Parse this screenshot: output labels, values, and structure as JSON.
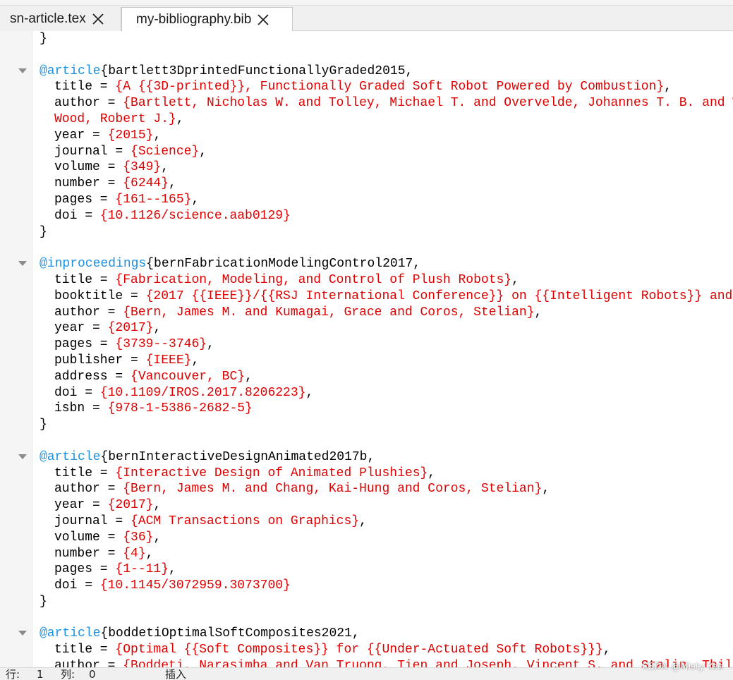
{
  "tabs": [
    {
      "label": "sn-article.tex",
      "active": false
    },
    {
      "label": "my-bibliography.bib",
      "active": true
    }
  ],
  "colors": {
    "entry_type": "#1e90e0",
    "value": "#e00000",
    "text": "#000000"
  },
  "editor": {
    "lines": [
      {
        "kind": "brace",
        "text": "}"
      },
      {
        "kind": "blank"
      },
      {
        "kind": "entry",
        "type": "@article",
        "key": "{bartlett3DprintedFunctionallyGraded2015,"
      },
      {
        "kind": "field",
        "name": "title = ",
        "value": "{A {{3D-printed}}, Functionally Graded Soft Robot Powered by Combustion}",
        "tail": ","
      },
      {
        "kind": "field",
        "name": "author = ",
        "value": "{Bartlett, Nicholas W. and Tolley, Michael T. and Overvelde, Johannes T. B. and W",
        "tail": ""
      },
      {
        "kind": "cont",
        "value": "Wood, Robert J.}",
        "tail": ","
      },
      {
        "kind": "field",
        "name": "year = ",
        "value": "{2015}",
        "tail": ","
      },
      {
        "kind": "field",
        "name": "journal = ",
        "value": "{Science}",
        "tail": ","
      },
      {
        "kind": "field",
        "name": "volume = ",
        "value": "{349}",
        "tail": ","
      },
      {
        "kind": "field",
        "name": "number = ",
        "value": "{6244}",
        "tail": ","
      },
      {
        "kind": "field",
        "name": "pages = ",
        "value": "{161--165}",
        "tail": ","
      },
      {
        "kind": "field",
        "name": "doi = ",
        "value": "{10.1126/science.aab0129}",
        "tail": ""
      },
      {
        "kind": "brace",
        "text": "}"
      },
      {
        "kind": "blank"
      },
      {
        "kind": "entry",
        "type": "@inproceedings",
        "key": "{bernFabricationModelingControl2017,"
      },
      {
        "kind": "field",
        "name": "title = ",
        "value": "{Fabrication, Modeling, and Control of Plush Robots}",
        "tail": ","
      },
      {
        "kind": "field",
        "name": "booktitle = ",
        "value": "{2017 {{IEEE}}/{{RSJ International Conference}} on {{Intelligent Robots}} and",
        "tail": ""
      },
      {
        "kind": "field",
        "name": "author = ",
        "value": "{Bern, James M. and Kumagai, Grace and Coros, Stelian}",
        "tail": ","
      },
      {
        "kind": "field",
        "name": "year = ",
        "value": "{2017}",
        "tail": ","
      },
      {
        "kind": "field",
        "name": "pages = ",
        "value": "{3739--3746}",
        "tail": ","
      },
      {
        "kind": "field",
        "name": "publisher = ",
        "value": "{IEEE}",
        "tail": ","
      },
      {
        "kind": "field",
        "name": "address = ",
        "value": "{Vancouver, BC}",
        "tail": ","
      },
      {
        "kind": "field",
        "name": "doi = ",
        "value": "{10.1109/IROS.2017.8206223}",
        "tail": ","
      },
      {
        "kind": "field",
        "name": "isbn = ",
        "value": "{978-1-5386-2682-5}",
        "tail": ""
      },
      {
        "kind": "brace",
        "text": "}"
      },
      {
        "kind": "blank"
      },
      {
        "kind": "entry",
        "type": "@article",
        "key": "{bernInteractiveDesignAnimated2017b,"
      },
      {
        "kind": "field",
        "name": "title = ",
        "value": "{Interactive Design of Animated Plushies}",
        "tail": ","
      },
      {
        "kind": "field",
        "name": "author = ",
        "value": "{Bern, James M. and Chang, Kai-Hung and Coros, Stelian}",
        "tail": ","
      },
      {
        "kind": "field",
        "name": "year = ",
        "value": "{2017}",
        "tail": ","
      },
      {
        "kind": "field",
        "name": "journal = ",
        "value": "{ACM Transactions on Graphics}",
        "tail": ","
      },
      {
        "kind": "field",
        "name": "volume = ",
        "value": "{36}",
        "tail": ","
      },
      {
        "kind": "field",
        "name": "number = ",
        "value": "{4}",
        "tail": ","
      },
      {
        "kind": "field",
        "name": "pages = ",
        "value": "{1--11}",
        "tail": ","
      },
      {
        "kind": "field",
        "name": "doi = ",
        "value": "{10.1145/3072959.3073700}",
        "tail": ""
      },
      {
        "kind": "brace",
        "text": "}"
      },
      {
        "kind": "blank"
      },
      {
        "kind": "entry",
        "type": "@article",
        "key": "{boddetiOptimalSoftComposites2021,"
      },
      {
        "kind": "field",
        "name": "title = ",
        "value": "{Optimal {{Soft Composites}} for {{Under-Actuated Soft Robots}}}",
        "tail": ","
      },
      {
        "kind": "field",
        "name": "author = ",
        "value": "{Boddeti, Narasimha and Van Truong, Tien and Joseph, Vincent S. and Stalin, Thile",
        "tail": ""
      }
    ]
  },
  "statusbar": {
    "line_label": "行:",
    "line_value": "1",
    "col_label": "列:",
    "col_value": "0",
    "mode": "插入"
  },
  "watermark": "CSDN @Misty Yee"
}
